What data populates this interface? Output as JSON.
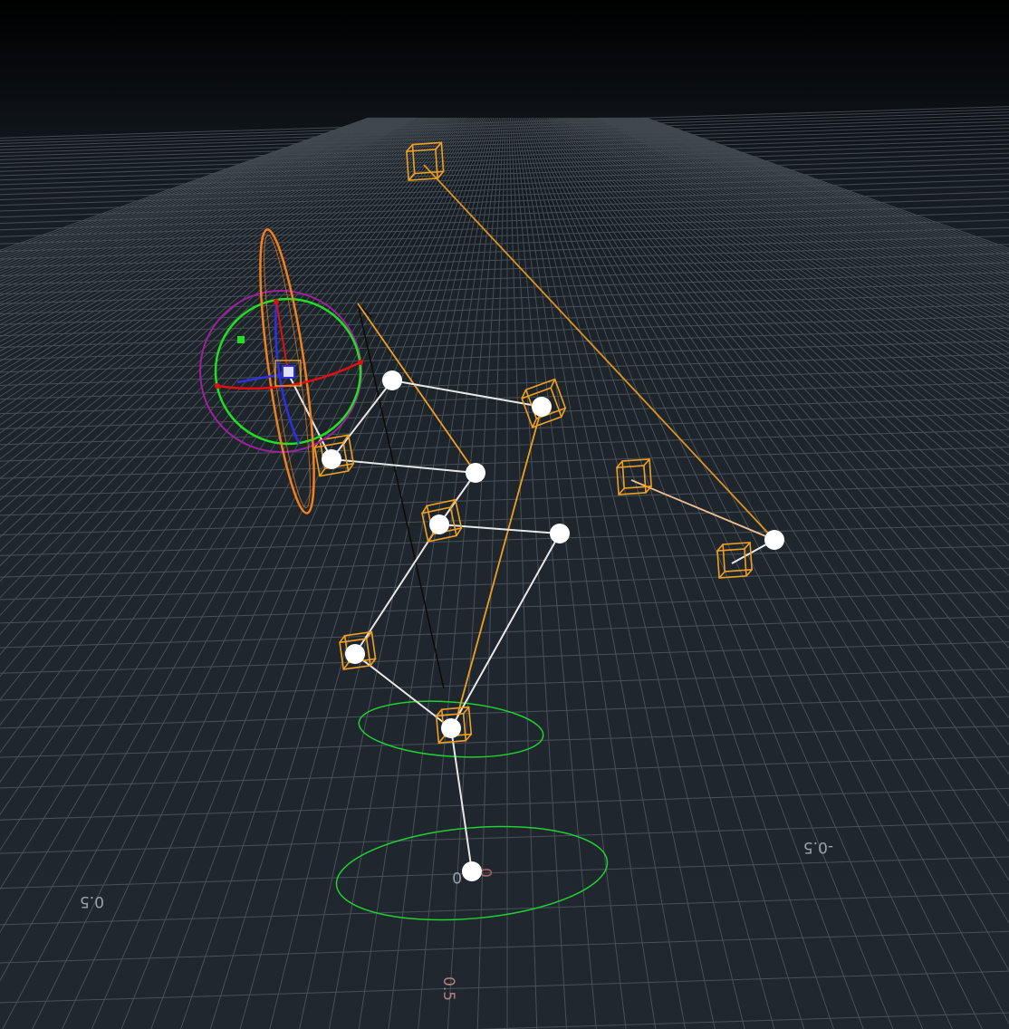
{
  "viewport": {
    "colors": {
      "grid": "#6b737b",
      "bone": "#e8e8e8",
      "joint": "#ffffff",
      "controller": "#f0a020",
      "rotate_outer": "#a020a0",
      "rotate_mid": "#20e020",
      "rotate_x": "#e01010",
      "rotate_y": "#3030e0",
      "rotate_z": "#f08020",
      "foot_ring": "#20d030",
      "axis_label": "#9aa3ab",
      "axis_label_origin": "#b06060"
    },
    "axis_labels": {
      "neg_half": "-0.5",
      "pos_half_left": "0.5",
      "origin": "0",
      "pos_half_bottom": "0.5",
      "near_origin_dup": "0"
    },
    "icons": {
      "transform_handle": "rotate-gizmo-icon",
      "ik_control": "controller-box-icon"
    }
  }
}
